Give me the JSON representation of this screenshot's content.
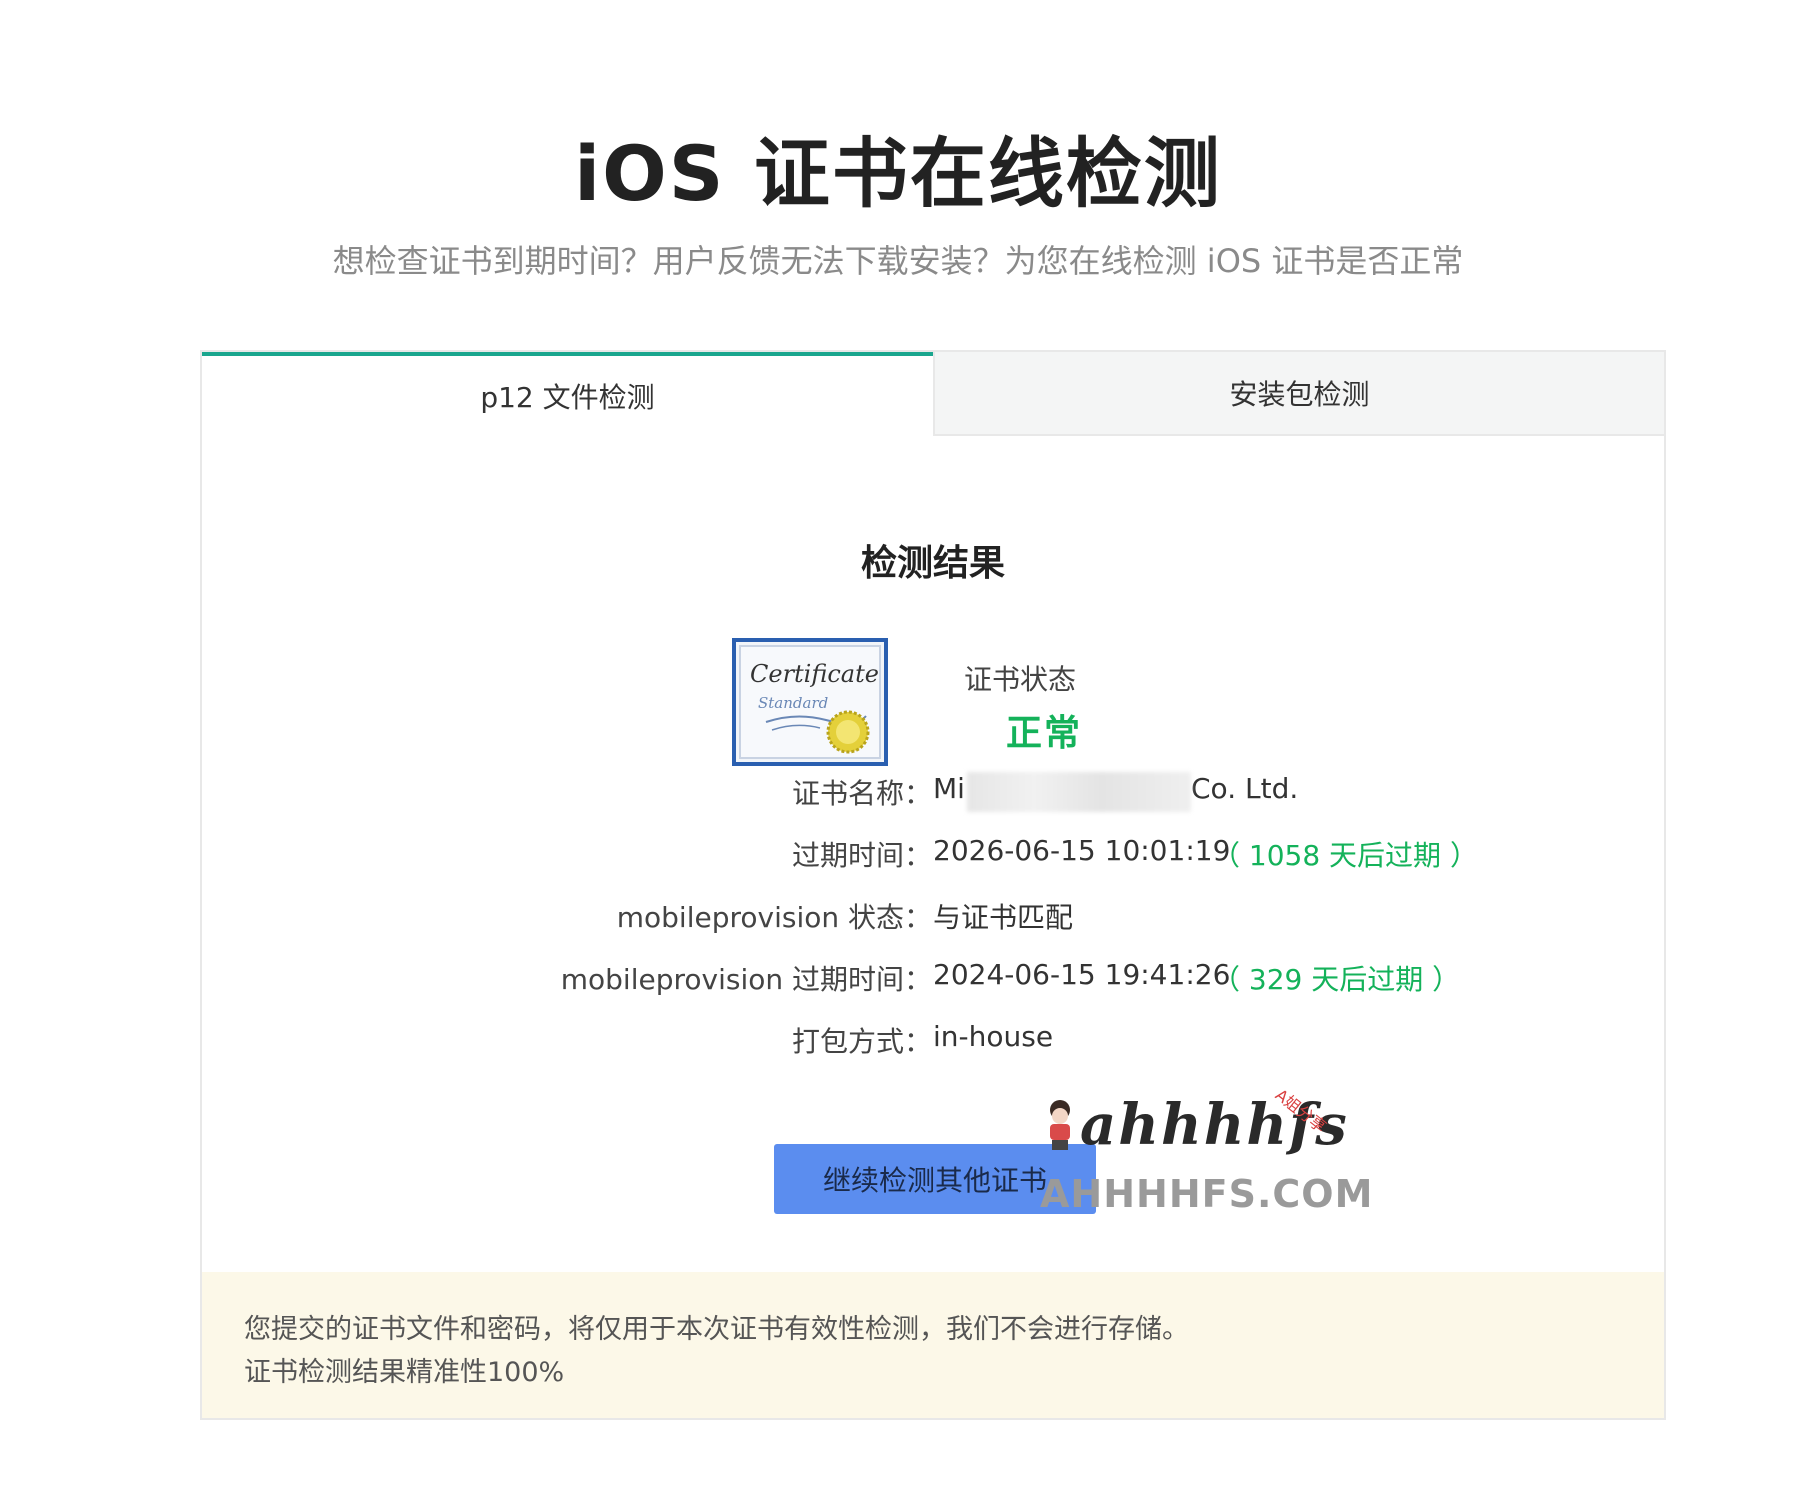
{
  "header": {
    "title": "iOS 证书在线检测",
    "subtitle": "想检查证书到期时间？用户反馈无法下载安装？为您在线检测 iOS 证书是否正常"
  },
  "tabs": [
    {
      "label": "p12 文件检测",
      "active": true
    },
    {
      "label": "安装包检测",
      "active": false
    }
  ],
  "result": {
    "title": "检测结果",
    "status_label": "证书状态",
    "status_value": "正常",
    "cert_image_text": {
      "line1": "Certificate",
      "line2": "Standard"
    },
    "rows": {
      "name": {
        "label": "证书名称：",
        "value_start": "Mi",
        "value_end": "Co. Ltd."
      },
      "expire": {
        "label": "过期时间：",
        "value": "2026-06-15 10:01:19",
        "note": "（ 1058 天后过期 ）"
      },
      "mp_status": {
        "label": "mobileprovision 状态：",
        "value": "与证书匹配"
      },
      "mp_expire": {
        "label": "mobileprovision 过期时间：",
        "value": "2024-06-15 19:41:26",
        "note": "（ 329 天后过期 ）"
      },
      "pack": {
        "label": "打包方式：",
        "value": "in-house"
      }
    },
    "button_label": "继续检测其他证书"
  },
  "watermark": {
    "script": "ahhhhfs",
    "small": "A姐分享",
    "url": "AHHHHFS.COM"
  },
  "notice": {
    "line1": "您提交的证书文件和密码，将仅用于本次证书有效性检测，我们不会进行存储。",
    "line2": "证书检测结果精准性100%"
  },
  "colors": {
    "accent": "#1aa68e",
    "success": "#14b25a",
    "button": "#5b8def",
    "notice_bg": "#fcf8e8"
  }
}
